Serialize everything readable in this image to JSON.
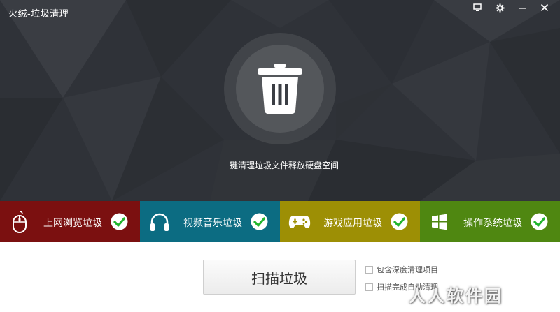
{
  "window": {
    "title": "火绒-垃圾清理",
    "controls": [
      {
        "name": "monitor-icon"
      },
      {
        "name": "gear-icon"
      },
      {
        "name": "minimize-icon"
      },
      {
        "name": "close-icon"
      }
    ]
  },
  "hero": {
    "bin_icon": "trash-bin-icon",
    "slogan": "一键清理垃圾文件释放硬盘空间"
  },
  "categories": [
    {
      "label": "上网浏览垃圾",
      "icon": "mouse-icon",
      "color": "#7b1010",
      "checked": true
    },
    {
      "label": "视频音乐垃圾",
      "icon": "headphones-icon",
      "color": "#0c6c82",
      "checked": true
    },
    {
      "label": "游戏应用垃圾",
      "icon": "gamepad-icon",
      "color": "#9d8f05",
      "checked": true
    },
    {
      "label": "操作系统垃圾",
      "icon": "windows-logo-icon",
      "color": "#4f8711",
      "checked": true
    }
  ],
  "scan_button": {
    "label": "扫描垃圾"
  },
  "options": [
    {
      "label": "包含深度清理项目",
      "checked": false
    },
    {
      "label": "扫描完成自动清理",
      "checked": false
    }
  ],
  "watermark": "人人软件园",
  "colors": {
    "hero_bg": "#2f3238",
    "check_green": "#22b52e"
  }
}
